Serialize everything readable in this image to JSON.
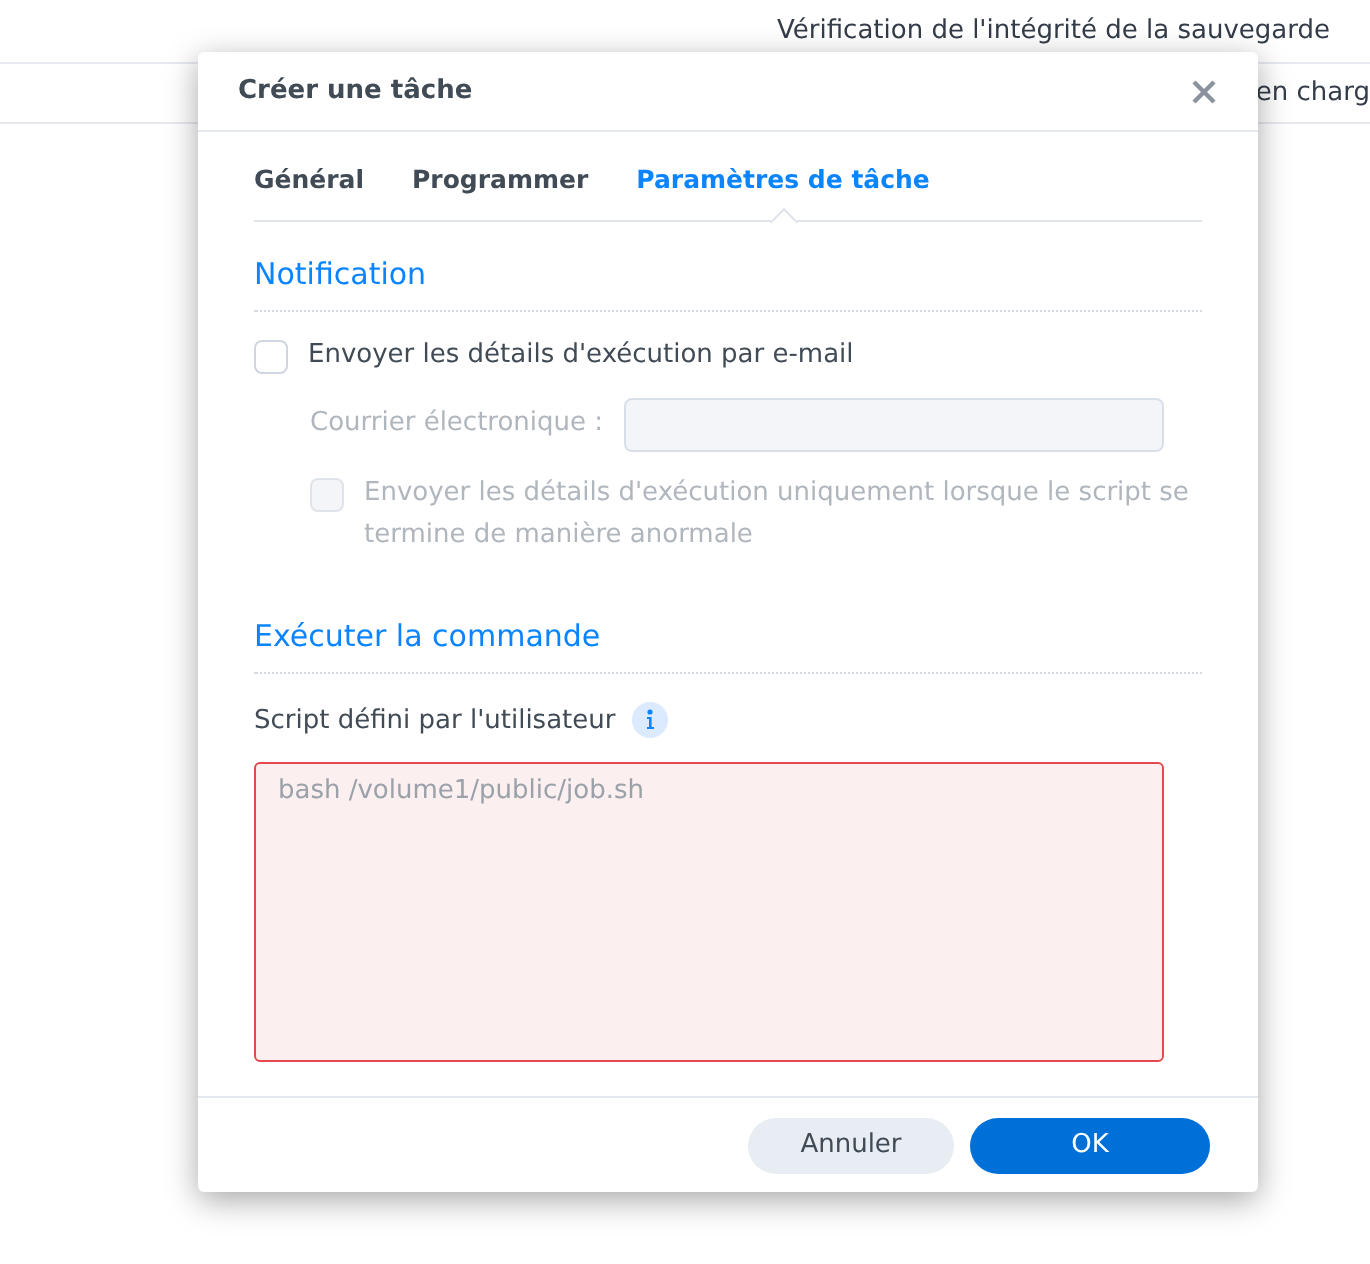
{
  "background_rows": [
    {
      "text": "Vérification de l'intégrité de la sauvegarde"
    },
    {
      "text": "en charg"
    }
  ],
  "dialog": {
    "title": "Créer une tâche",
    "tabs": [
      {
        "label": "Général",
        "selected": false
      },
      {
        "label": "Programmer",
        "selected": false
      },
      {
        "label": "Paramètres de tâche",
        "selected": true
      }
    ],
    "notification": {
      "heading": "Notification",
      "email_checkbox": {
        "label": "Envoyer les détails d'exécution par e-mail",
        "checked": false
      },
      "email_field": {
        "label": "Courrier électronique :",
        "disabled": true
      },
      "abnormal_checkbox": {
        "label": "Envoyer les détails d'exécution uniquement lorsque le script se termine de manière anormale",
        "checked": false,
        "disabled": true
      }
    },
    "command": {
      "heading": "Exécuter la commande",
      "script_label": "Script défini par l'utilisateur",
      "script_field": {
        "placeholder": "bash /volume1/public/job.sh",
        "error": true
      }
    },
    "buttons": [
      {
        "label": "Annuler",
        "kind": "secondary"
      },
      {
        "label": "OK",
        "kind": "primary"
      }
    ]
  }
}
